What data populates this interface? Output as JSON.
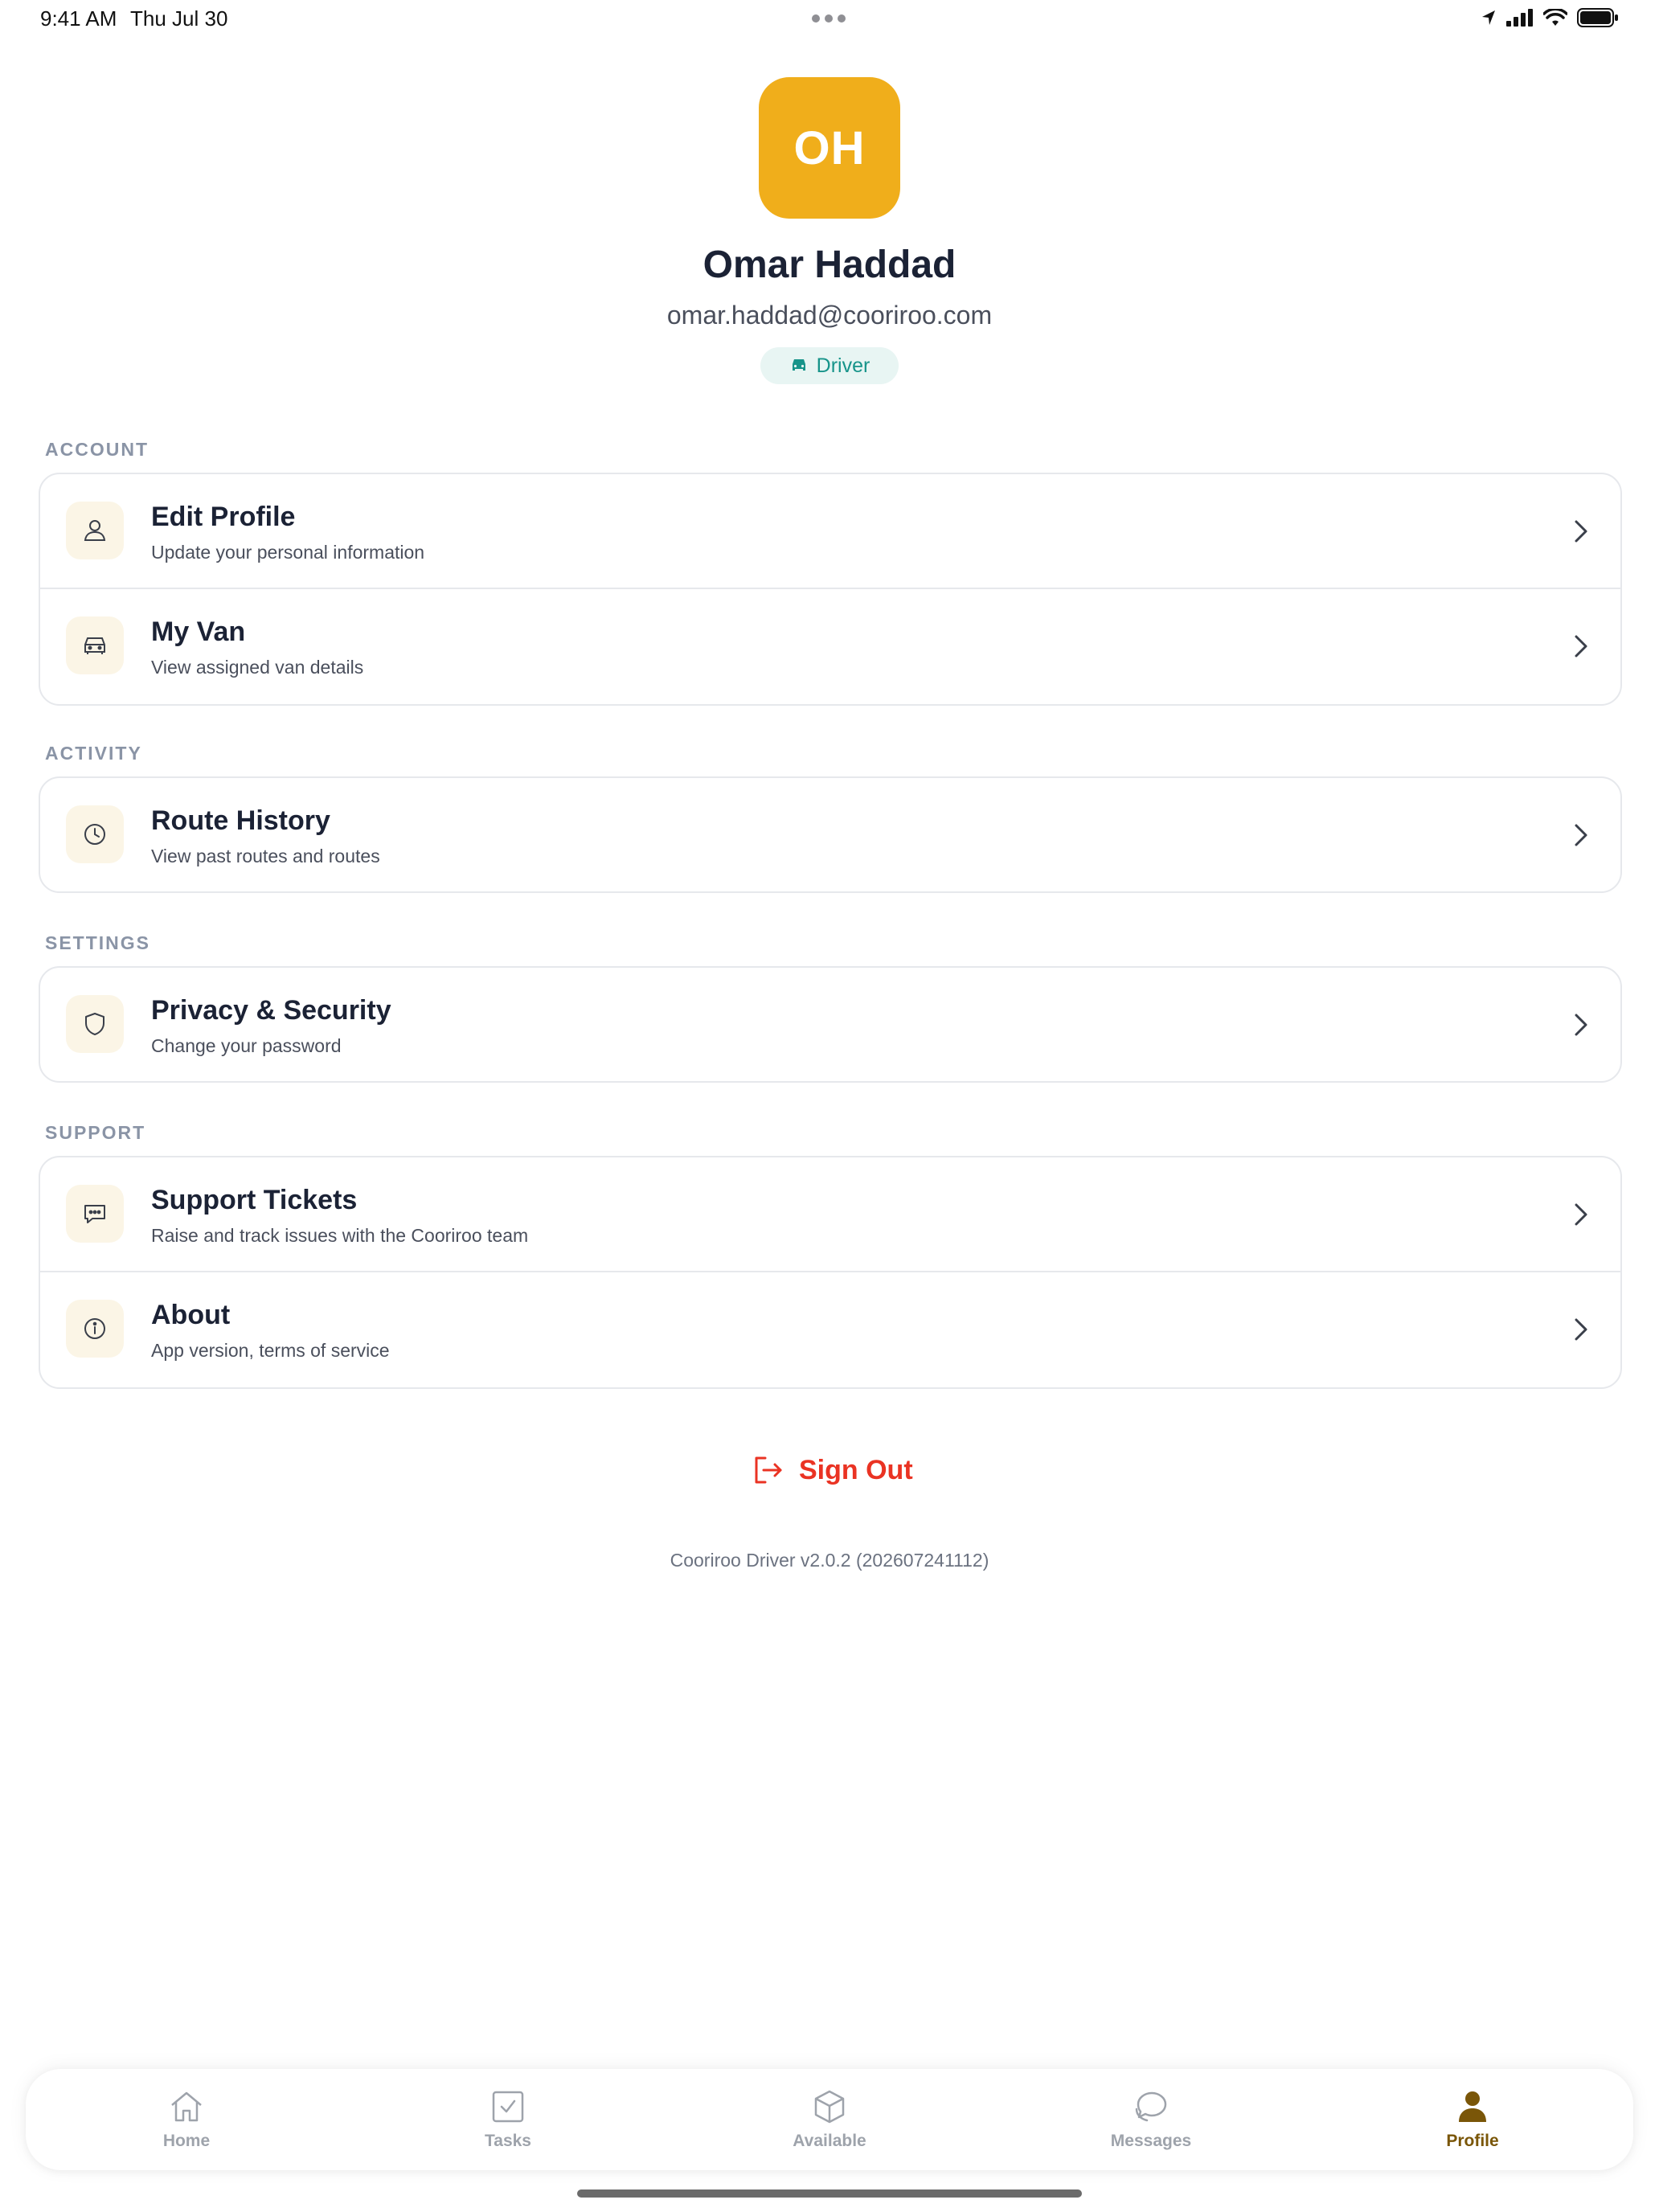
{
  "status_bar": {
    "time": "9:41 AM",
    "date": "Thu Jul 30"
  },
  "profile": {
    "initials": "OH",
    "name": "Omar Haddad",
    "email": "omar.haddad@cooriroo.com",
    "role": "Driver",
    "avatar_color": "#f0ae1b"
  },
  "sections": {
    "account": {
      "label": "ACCOUNT",
      "items": [
        {
          "title": "Edit Profile",
          "subtitle": "Update your personal information",
          "icon": "user-icon"
        },
        {
          "title": "My Van",
          "subtitle": "View assigned van details",
          "icon": "car-icon"
        }
      ]
    },
    "activity": {
      "label": "ACTIVITY",
      "items": [
        {
          "title": "Route History",
          "subtitle": "View past routes and routes",
          "icon": "clock-icon"
        }
      ]
    },
    "settings": {
      "label": "SETTINGS",
      "items": [
        {
          "title": "Privacy & Security",
          "subtitle": "Change your password",
          "icon": "shield-icon"
        }
      ]
    },
    "support": {
      "label": "SUPPORT",
      "items": [
        {
          "title": "Support Tickets",
          "subtitle": "Raise and track issues with the Cooriroo team",
          "icon": "chat-icon"
        },
        {
          "title": "About",
          "subtitle": "App version, terms of service",
          "icon": "info-icon"
        }
      ]
    }
  },
  "sign_out": {
    "label": "Sign Out",
    "color": "#ea3323"
  },
  "version": "Cooriroo Driver v2.0.2 (202607241112)",
  "tabs": [
    {
      "label": "Home",
      "icon": "home-icon",
      "active": false
    },
    {
      "label": "Tasks",
      "icon": "checkbox-icon",
      "active": false
    },
    {
      "label": "Available",
      "icon": "box-icon",
      "active": false
    },
    {
      "label": "Messages",
      "icon": "message-icon",
      "active": false
    },
    {
      "label": "Profile",
      "icon": "person-icon",
      "active": true
    }
  ],
  "colors": {
    "accent": "#f0ae1b",
    "active_tab": "#7a5608",
    "badge_text": "#17948a",
    "badge_bg": "#e8f5f3"
  }
}
